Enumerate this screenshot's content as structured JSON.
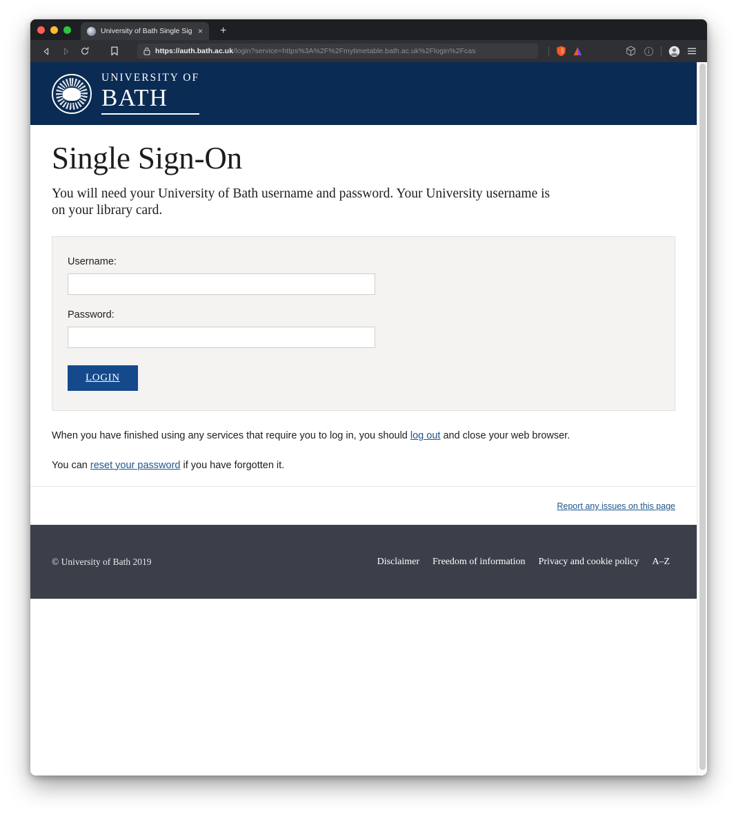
{
  "browser": {
    "tab": {
      "title": "University of Bath Single Sign-o",
      "favicon_name": "bath-crest-favicon",
      "close_label": "×"
    },
    "new_tab_label": "+",
    "toolbar": {
      "back_icon": "back-arrow-icon",
      "forward_icon": "forward-arrow-icon",
      "reload_icon": "reload-icon",
      "bookmark_icon": "bookmark-icon",
      "lock_icon": "padlock-icon",
      "url_domain": "https://auth.bath.ac.uk",
      "url_path": "/login?service=https%3A%2F%2Fmytimetable.bath.ac.uk%2Flogin%2Fcas",
      "url_full": "https://auth.bath.ac.uk/login?service=https%3A%2F%2Fmytimetable.bath.ac.uk%2Flogin%2Fcas",
      "shield_icon": "brave-shield-icon",
      "brave_icon": "brave-logo-icon",
      "wallet_icon": "brave-wallet-cube-icon",
      "info_icon": "info-circle-icon",
      "profile_icon": "profile-avatar-icon",
      "menu_icon": "hamburger-menu-icon"
    }
  },
  "site_header": {
    "crest_icon": "university-of-bath-crest",
    "brand_line1": "UNIVERSITY OF",
    "brand_line2": "BATH",
    "background_color": "#0a2b53"
  },
  "main": {
    "page_title": "Single Sign-On",
    "intro_text": "You will need your University of Bath username and password. Your University username is on your library card.",
    "form": {
      "username_label": "Username:",
      "username_value": "",
      "username_placeholder": "",
      "password_label": "Password:",
      "password_value": "",
      "password_placeholder": "",
      "login_button_label": "LOGIN",
      "login_button_color": "#14498c",
      "panel_background": "#f4f3f1"
    },
    "notes": {
      "logout_note_before": "When you have finished using any services that require you to log in, you should ",
      "logout_link": "log out",
      "logout_note_after": " and close your web browser.",
      "reset_note_before": "You can ",
      "reset_link": "reset your password",
      "reset_note_after": " if you have forgotten it."
    },
    "report_issues_link": "Report any issues on this page",
    "link_color": "#20558a"
  },
  "site_footer": {
    "copyright": "© University of Bath 2019",
    "links": [
      {
        "label": "Disclaimer"
      },
      {
        "label": "Freedom of information"
      },
      {
        "label": "Privacy and cookie policy"
      },
      {
        "label": "A–Z"
      }
    ],
    "background_color": "#3b3f4a"
  }
}
